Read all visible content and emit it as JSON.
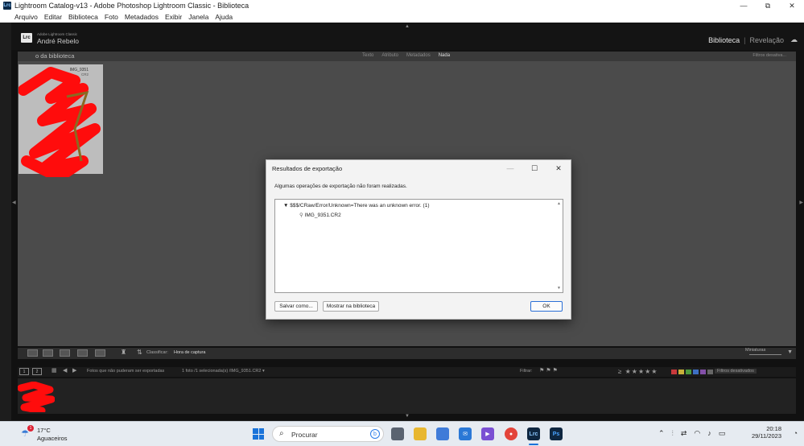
{
  "window": {
    "title": "Lightroom Catalog-v13 - Adobe Photoshop Lightroom Classic - Biblioteca",
    "app_icon": "Lrc",
    "controls": {
      "minimize": "—",
      "restore": "⧉",
      "close": "✕"
    }
  },
  "menu": [
    "Arquivo",
    "Editar",
    "Biblioteca",
    "Foto",
    "Metadados",
    "Exibir",
    "Janela",
    "Ajuda"
  ],
  "identity": {
    "logo": "Lrc",
    "brand": "Adobe Lightroom Classic",
    "user": "André Rebelo"
  },
  "modules": {
    "library": "Biblioteca",
    "separator": "|",
    "develop": "Revelação"
  },
  "library_filter": {
    "label": "o da biblioteca",
    "tabs": [
      "Texto",
      "Atributo",
      "Metadados",
      "Nada"
    ],
    "active_tab": "Nada",
    "presets": "Filtros desativa..."
  },
  "grid": {
    "thumbnail": {
      "name": "IMG_9351",
      "ext": "CR2"
    }
  },
  "toolbar": {
    "sort_label": "Classificar:",
    "sort_value": "Hora de captura",
    "thumb_label": "Miniaturas"
  },
  "filmstrip_bar": {
    "page1": "1",
    "page2": "2",
    "source": "Fotos que não puderam ser exportadas",
    "count": "1 foto /1 selecionada(s) /IMG_9351.CR2 ▾",
    "filter_label": "Filtrar:",
    "stars": "≥ ★★★★★",
    "filter_preset": "Filtros desativados"
  },
  "dialog": {
    "title": "Resultados de exportação",
    "message": "Algumas operações de exportação não foram realizadas.",
    "error_group": "$$$/CRaw/Error/Unknown=There was an unknown error. (1)",
    "error_file": "IMG_9351.CR2",
    "buttons": {
      "save": "Salvar como...",
      "show": "Mostrar na biblioteca",
      "ok": "OK"
    }
  },
  "taskbar": {
    "weather": {
      "temp": "17°C",
      "condition": "Aguaceiros",
      "badge": "1"
    },
    "search_placeholder": "Procurar",
    "time": "20:18",
    "date": "29/11/2023"
  },
  "colors": {
    "red_label": "#c8393b",
    "yellow_label": "#c9b13a",
    "green_label": "#4c9a3d",
    "blue_label": "#3d6fc2",
    "purple_label": "#8350a8",
    "redaction": "#ff0c0c"
  }
}
